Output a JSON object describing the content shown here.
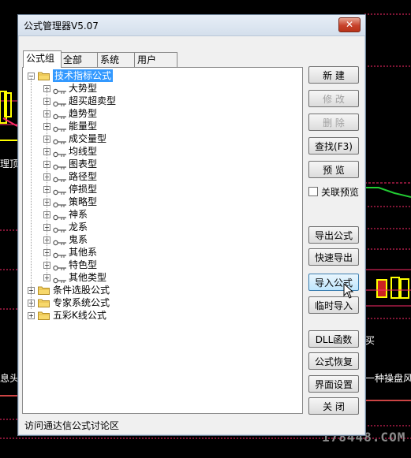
{
  "background": {
    "left_labels": [
      "理顶"
    ],
    "bottom_left_label": "息头",
    "bottom_right_label": "一种操盘风",
    "mid_right_label": "买",
    "watermark": "178448.COM"
  },
  "window": {
    "title": "公式管理器V5.07",
    "close_glyph": "✕"
  },
  "tabs": [
    "公式组",
    "全部",
    "系统",
    "用户"
  ],
  "tree": {
    "root": "技术指标公式",
    "children": [
      "大势型",
      "超买超卖型",
      "趋势型",
      "能量型",
      "成交量型",
      "均线型",
      "图表型",
      "路径型",
      "停损型",
      "策略型",
      "神系",
      "龙系",
      "鬼系",
      "其他系",
      "特色型",
      "其他类型"
    ],
    "other_roots": [
      "条件选股公式",
      "专家系统公式",
      "五彩K线公式"
    ]
  },
  "buttons": {
    "new": "新  建",
    "modify": "修  改",
    "delete": "删  除",
    "find": "查找(F3)",
    "preview": "预  览",
    "link_preview": "关联预览",
    "export": "导出公式",
    "quick_export": "快速导出",
    "import": "导入公式",
    "temp_import": "临时导入",
    "dll": "DLL函数",
    "restore": "公式恢复",
    "ui_settings": "界面设置",
    "close": "关  闭"
  },
  "status": "访问通达信公式讨论区",
  "colors": {
    "selection": "#3399ff",
    "chart_line_red": "#ff2a6a",
    "chart_line_green": "#22cc33",
    "chart_yellow": "#ffff00"
  }
}
